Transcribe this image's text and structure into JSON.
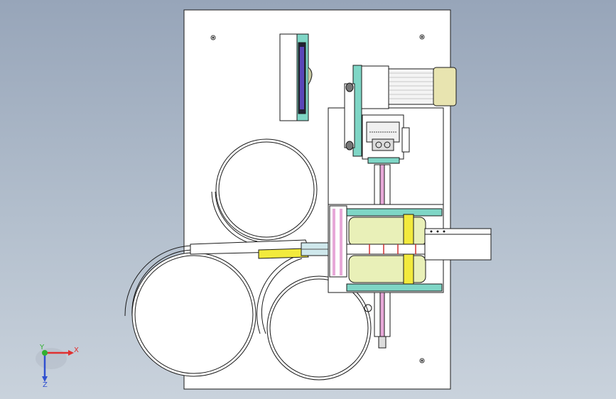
{
  "triad": {
    "x_label": "X",
    "y_label": "Y",
    "z_label": "Z"
  },
  "colors": {
    "background_top": "#97a5b9",
    "background_bottom": "#c9d2dc",
    "plate": "#ffffff",
    "outline": "#1a1a1a",
    "teal_part": "#7fd6c6",
    "yellow_part": "#f2ea3c",
    "pink_rod": "#e7a8d8",
    "motor_body": "#e8e4b0",
    "x_axis": "#e03030",
    "y_axis": "#30b030",
    "z_axis": "#3050d0"
  }
}
